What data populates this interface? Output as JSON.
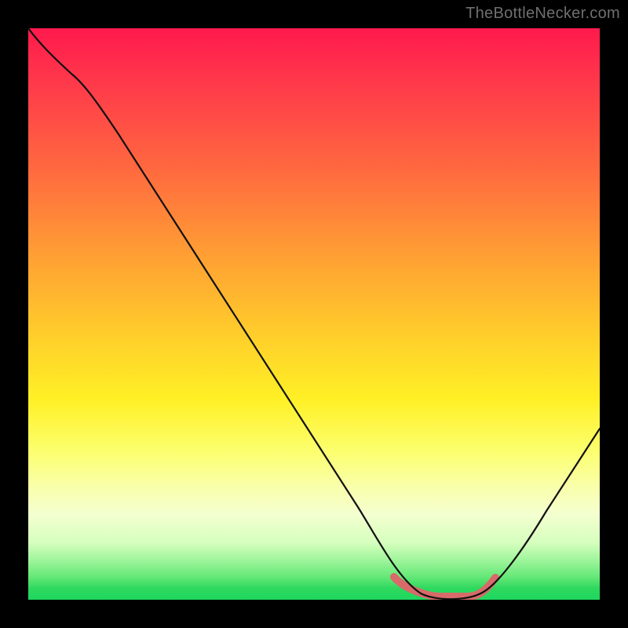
{
  "watermark": "TheBottleNecker.com",
  "chart_data": {
    "type": "line",
    "title": "",
    "xlabel": "",
    "ylabel": "",
    "xlim": [
      0,
      100
    ],
    "ylim": [
      0,
      100
    ],
    "x": [
      0,
      3,
      6,
      10,
      20,
      30,
      40,
      50,
      60,
      64,
      68,
      72,
      76,
      80,
      85,
      90,
      95,
      100
    ],
    "values": [
      100,
      98,
      96,
      92,
      78,
      63,
      48,
      33,
      18,
      10,
      4,
      0,
      0,
      0,
      5,
      12,
      20,
      28
    ],
    "highlight_range_x": [
      64,
      80
    ],
    "gradient_stops": [
      {
        "pos": 0.0,
        "color": "#ff1a4d"
      },
      {
        "pos": 0.25,
        "color": "#ff6a3f"
      },
      {
        "pos": 0.55,
        "color": "#ffd22a"
      },
      {
        "pos": 0.75,
        "color": "#fcff6e"
      },
      {
        "pos": 0.93,
        "color": "#a0f59c"
      },
      {
        "pos": 1.0,
        "color": "#1ed760"
      }
    ]
  }
}
